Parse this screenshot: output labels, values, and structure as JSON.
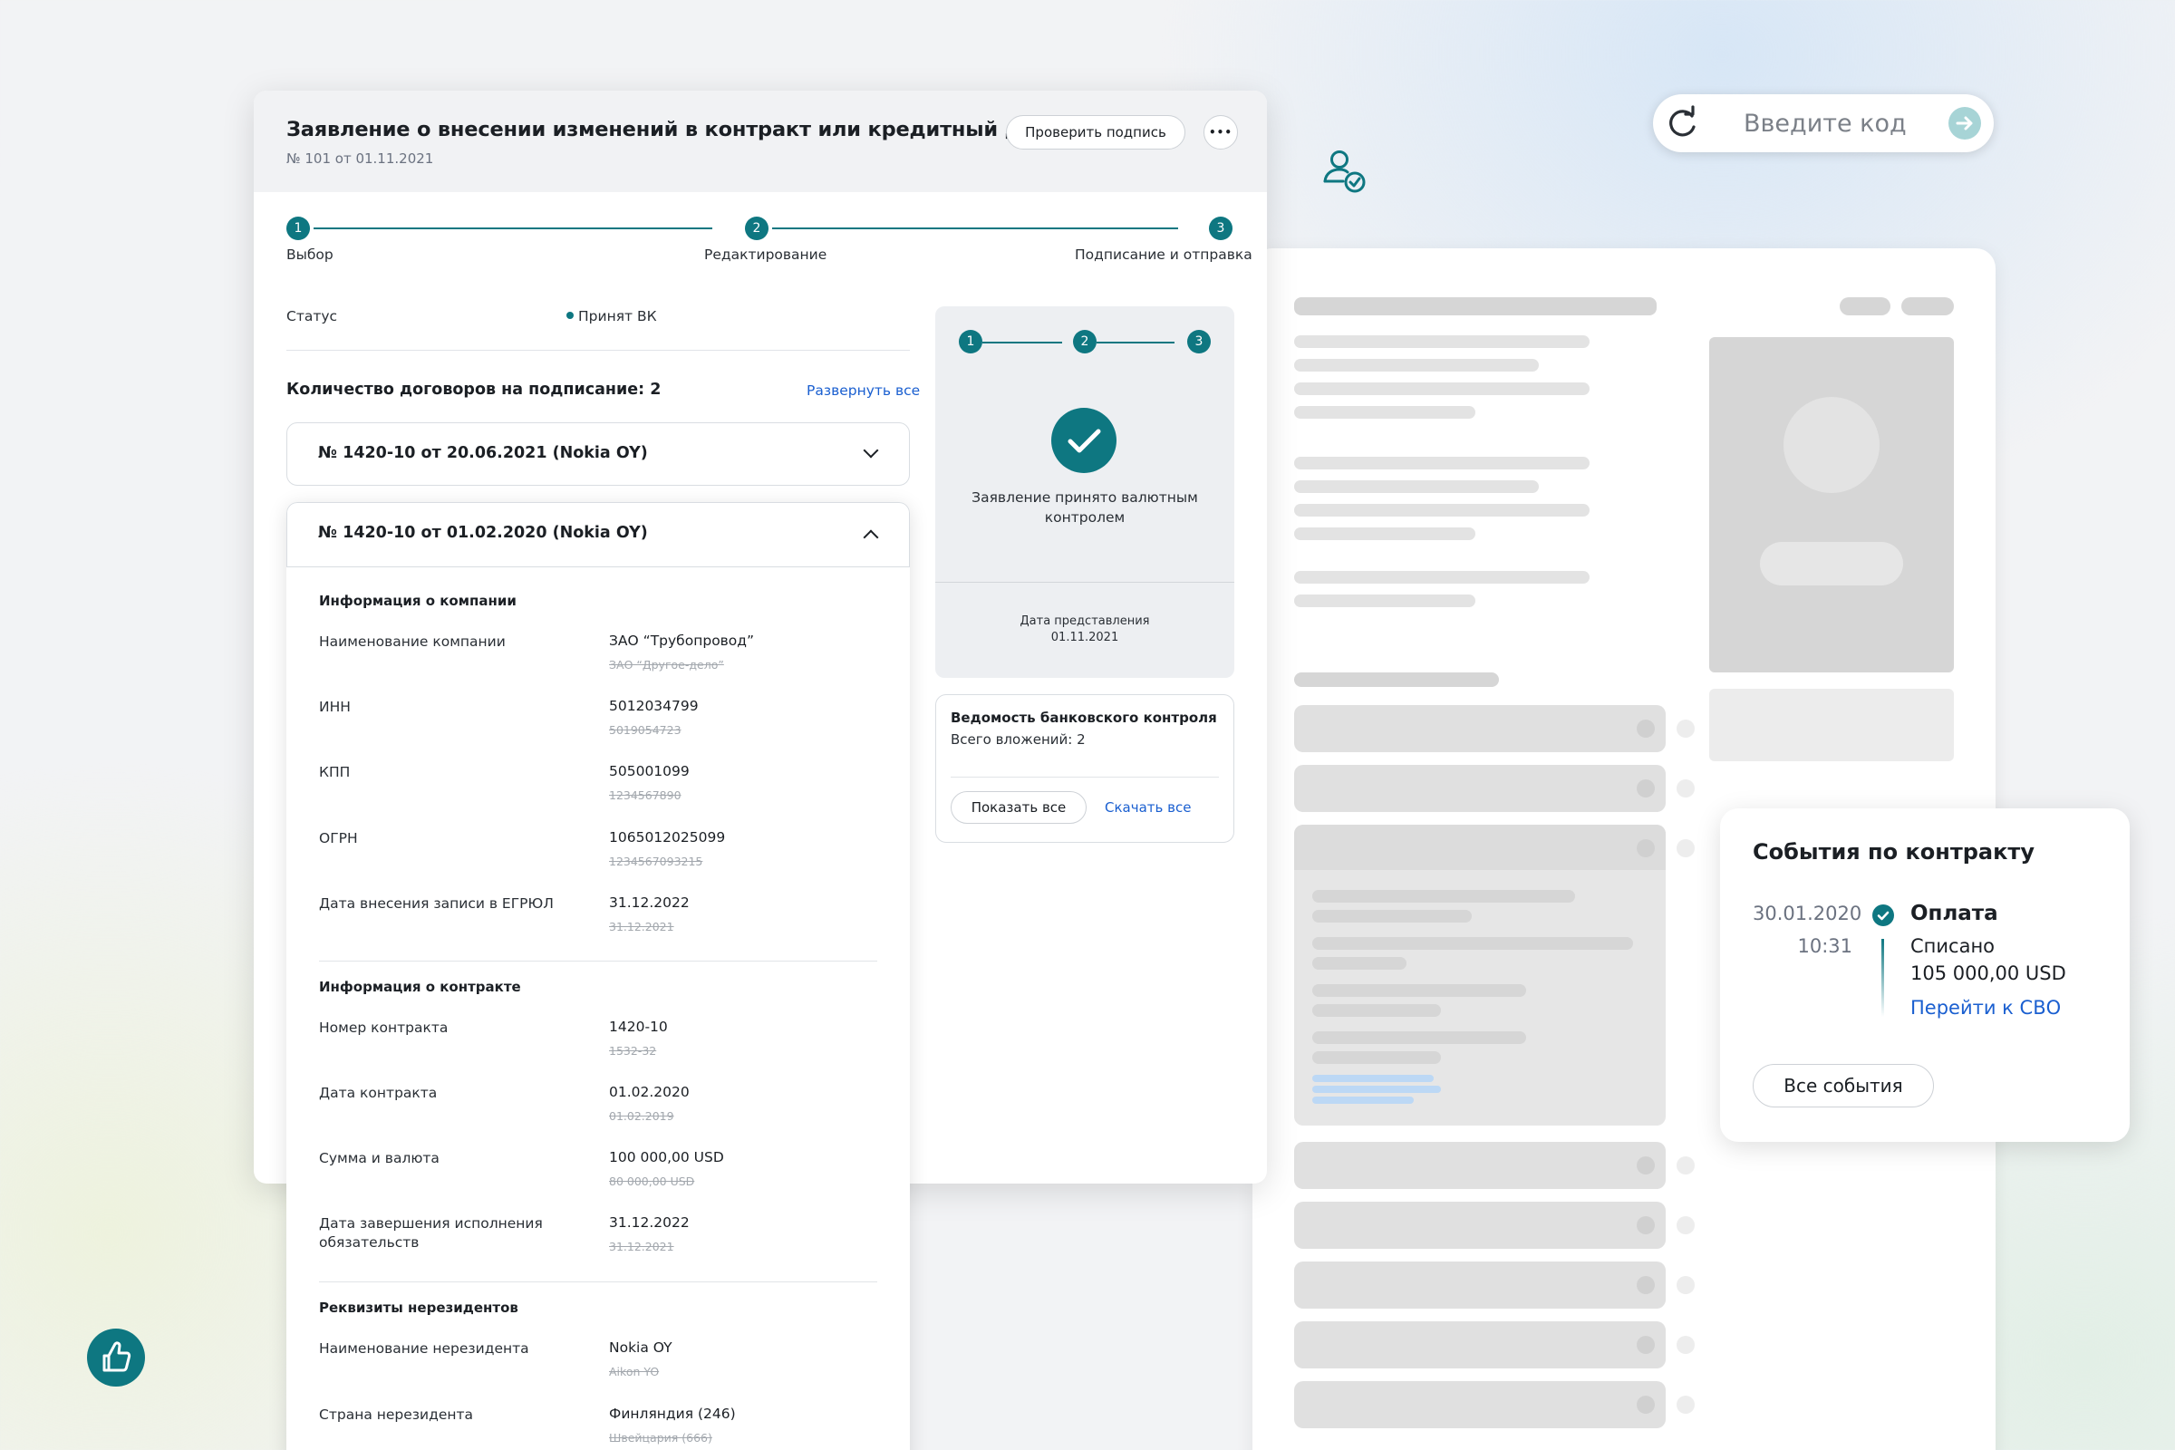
{
  "document": {
    "title": "Заявление о внесении изменений в контракт или кредитный договор",
    "subtitle": "№ 101 от 01.11.2021",
    "check_signature_label": "Проверить подпись",
    "more_label": "•••"
  },
  "stepper": {
    "steps": [
      {
        "number": "1",
        "label": "Выбор"
      },
      {
        "number": "2",
        "label": "Редактирование"
      },
      {
        "number": "3",
        "label": "Подписание и отправка"
      }
    ]
  },
  "status": {
    "label": "Статус",
    "value": "Принят ВК"
  },
  "contracts": {
    "count_title": "Количество договоров на подписание: 2",
    "expand_all_label": "Развернуть все",
    "collapsed_title": "№ 1420-10 от 20.06.2021 (Nokia OY)",
    "expanded_title": "№ 1420-10 от 01.02.2020 (Nokia OY)"
  },
  "company_info": {
    "title": "Информация о компании",
    "fields": [
      {
        "label": "Наименование компании",
        "value": "ЗАО “Трубопровод”",
        "old": "ЗАО “Другое-дело”"
      },
      {
        "label": "ИНН",
        "value": "5012034799",
        "old": "5019054723"
      },
      {
        "label": "КПП",
        "value": "505001099",
        "old": "1234567890"
      },
      {
        "label": "ОГРН",
        "value": "1065012025099",
        "old": "1234567093215"
      },
      {
        "label": "Дата внесения записи в ЕГРЮЛ",
        "value": "31.12.2022",
        "old": "31.12.2021"
      }
    ]
  },
  "contract_info": {
    "title": "Информация о контракте",
    "fields": [
      {
        "label": "Номер контракта",
        "value": "1420-10",
        "old": "1532-32"
      },
      {
        "label": "Дата контракта",
        "value": "01.02.2020",
        "old": "01.02.2019"
      },
      {
        "label": "Сумма и валюта",
        "value": "100 000,00 USD",
        "old": "80 000,00 USD"
      },
      {
        "label": "Дата завершения исполнения обязательств",
        "value": "31.12.2022",
        "old": "31.12.2021"
      }
    ]
  },
  "nonresident_info": {
    "title": "Реквизиты нерезидентов",
    "fields": [
      {
        "label": "Наименование нерезидента",
        "value": "Nokia OY",
        "old": "Aikon YO"
      },
      {
        "label": "Страна нерезидента",
        "value": "Финляндия (246)",
        "old": "Швейцария (666)"
      }
    ]
  },
  "summary_panel": {
    "steps": [
      "1",
      "2",
      "3"
    ],
    "accepted_text": "Заявление принято валютным контролем",
    "date_caption": "Дата представления",
    "date_value": "01.11.2021"
  },
  "bank_control": {
    "title": "Ведомость банковского контроля",
    "attachments": "Всего вложений: 2",
    "show_all_label": "Показать все",
    "download_all_label": "Скачать все"
  },
  "code_entry": {
    "placeholder": "Введите код"
  },
  "events": {
    "title": "События по контракту",
    "date": "30.01.2020",
    "time": "10:31",
    "name": "Оплата",
    "status": "Списано",
    "amount": "105 000,00 USD",
    "link_label": "Перейти к СВО",
    "all_events_label": "Все события"
  },
  "colors": {
    "accent": "#0e7781",
    "link": "#1a5fd0",
    "background": "#f2f3f5"
  },
  "icons": [
    "refresh-icon",
    "arrow-right-icon",
    "user-check-icon",
    "thumbs-up-icon",
    "check-icon",
    "chevron-down-icon",
    "chevron-up-icon",
    "more-icon"
  ]
}
